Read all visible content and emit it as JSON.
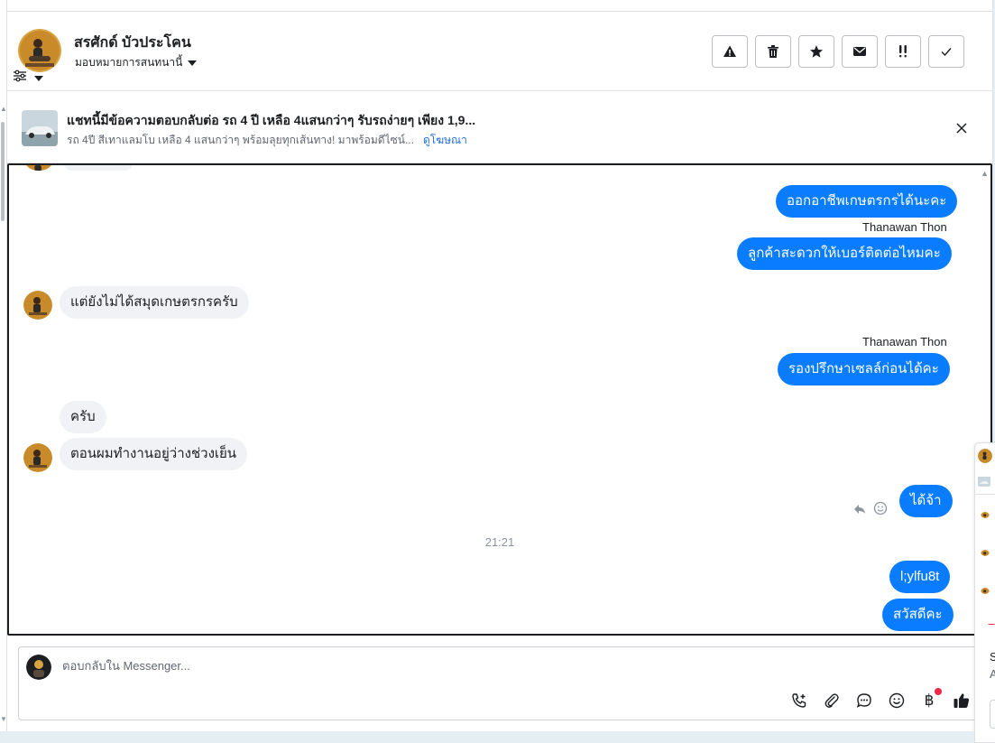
{
  "header": {
    "contact_name": "สรศักด์ บัวประโคน",
    "assign_label": "มอบหมายการสนทนานี้",
    "actions": [
      {
        "icon": "warning-icon"
      },
      {
        "icon": "trash-icon"
      },
      {
        "icon": "star-icon"
      },
      {
        "icon": "mail-icon"
      },
      {
        "icon": "priority-icon"
      },
      {
        "icon": "check-icon"
      }
    ]
  },
  "ad": {
    "title": "แชทนี้มีข้อความตอบกลับต่อ รถ 4 ปี เหลือ 4แสนกว่าๆ รับรถง่ายๆ เพียง 1,9...",
    "subtitle": "รถ 4ปี สีเทาแลมโบ เหลือ 4 แสนกว่าๆ พร้อมลุยทุกเส้นทาง! มาพร้อมดีไซน์...",
    "link": "ดูโฆษณา"
  },
  "messages": {
    "m1": "ออกอาชีพเกษตรกรได้นะคะ",
    "sender1": "Thanawan Thon",
    "m2": "ลูกค้าสะดวกให้เบอร์ติดต่อไหมคะ",
    "m3": "แต่ยังไม่ได้สมุดเกษตรกรครับ",
    "sender2": "Thanawan Thon",
    "m4": "รองปรึกษาเซลล์ก่อนได้คะ",
    "m5": "ครับ",
    "m6": "ตอนผมทำงานอยู่ว่างช่วงเย็น",
    "m7": "ได้จ้า",
    "timestamp": "21:21",
    "m8": "l;ylfu8t",
    "m9": "สวัสดีคะ"
  },
  "composer": {
    "placeholder": "ตอบกลับใน Messenger...",
    "baht_symbol": "฿"
  },
  "side_panel": {
    "text_s": "S",
    "text_a": "A"
  },
  "colors": {
    "outgoing_bubble": "#0a7cff",
    "incoming_bubble": "#f0f2f5",
    "link": "#216fdb",
    "notification_dot": "#f02849"
  }
}
